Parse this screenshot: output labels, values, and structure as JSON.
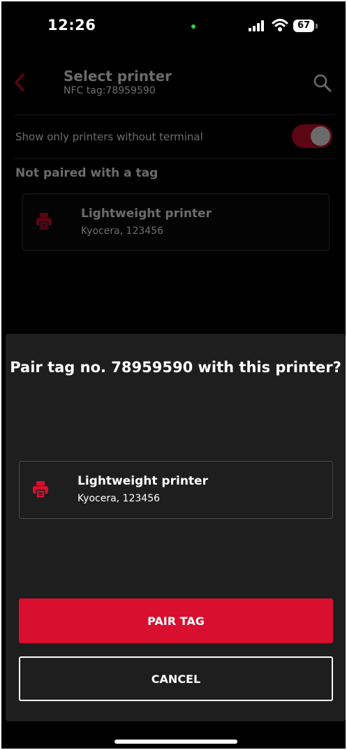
{
  "status_bar": {
    "time": "12:26",
    "battery": "67"
  },
  "header": {
    "title": "Select printer",
    "subtitle": "NFC tag:78959590",
    "back_icon": "chevron-left-icon",
    "search_icon": "search-icon"
  },
  "filter": {
    "label": "Show only printers without terminal",
    "toggle_on": true
  },
  "list": {
    "section_title": "Not paired with a tag",
    "items": [
      {
        "name": "Lightweight printer",
        "detail": "Kyocera, 123456",
        "icon": "printer-icon"
      }
    ]
  },
  "dialog": {
    "title": "Pair tag no. 78959590 with this printer?",
    "printer": {
      "name": "Lightweight printer",
      "detail": "Kyocera, 123456",
      "icon": "printer-icon"
    },
    "confirm_label": "PAIR TAG",
    "cancel_label": "CANCEL"
  },
  "colors": {
    "accent": "#d80f2f",
    "background": "#000000",
    "sheet": "#1e1e1e"
  }
}
